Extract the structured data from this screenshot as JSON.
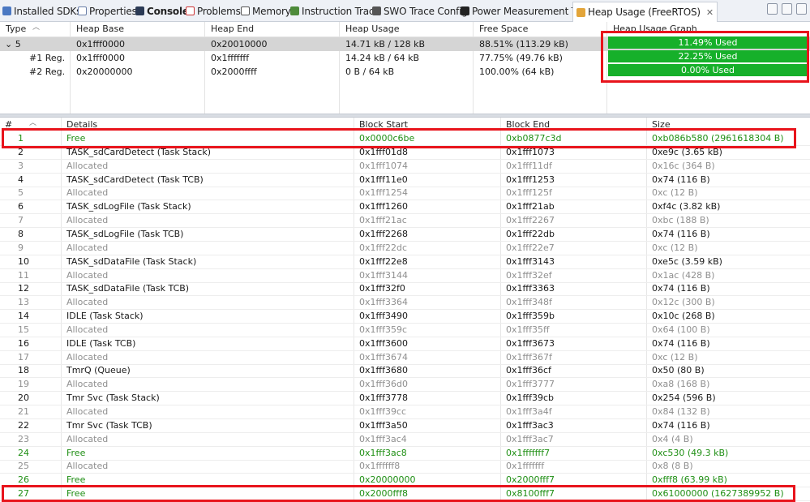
{
  "tabs": [
    {
      "label": "Installed SDKs",
      "icon": "sdk-icon",
      "active": false
    },
    {
      "label": "Properties",
      "icon": "properties-icon",
      "active": false
    },
    {
      "label": "Console",
      "icon": "console-icon",
      "active": false,
      "bold": true
    },
    {
      "label": "Problems",
      "icon": "problems-icon",
      "active": false
    },
    {
      "label": "Memory",
      "icon": "memory-icon",
      "active": false
    },
    {
      "label": "Instruction Trace",
      "icon": "trace-icon",
      "active": false
    },
    {
      "label": "SWO Trace Config",
      "icon": "swo-icon",
      "active": false
    },
    {
      "label": "Power Measurement Tool",
      "icon": "power-icon",
      "active": false
    },
    {
      "label": "Heap Usage (FreeRTOS)",
      "icon": "heap-icon",
      "active": true,
      "close": "✕"
    }
  ],
  "summary": {
    "columns": [
      "Type",
      "Heap Base",
      "Heap End",
      "Heap Usage",
      "Free Space",
      "Heap Usage Graph"
    ],
    "rows": [
      {
        "type": "5",
        "expander": "⌄",
        "base": "0x1fff0000",
        "end": "0x20010000",
        "usage": "14.71 kB / 128 kB",
        "free": "88.51% (113.29 kB)",
        "graph": "11.49% Used",
        "used_fraction": 1.0
      },
      {
        "type": "#1 Reg.",
        "base": "0x1fff0000",
        "end": "0x1fffffff",
        "usage": "14.24 kB / 64 kB",
        "free": "77.75% (49.76 kB)",
        "graph": "22.25% Used",
        "used_fraction": 1.0
      },
      {
        "type": "#2 Reg.",
        "base": "0x20000000",
        "end": "0x2000ffff",
        "usage": "0 B / 64 kB",
        "free": "100.00% (64 kB)",
        "graph": "0.00% Used",
        "used_fraction": 1.0
      }
    ]
  },
  "detail": {
    "columns": [
      "#",
      "Details",
      "Block Start",
      "Block End",
      "Size"
    ],
    "rows": [
      {
        "n": "1",
        "details": "Free",
        "start": "0x0000c6be",
        "end": "0xb0877c3d",
        "size": "0xb086b580 (2961618304 B)",
        "kind": "free"
      },
      {
        "n": "2",
        "details": "TASK_sdCardDetect (Task Stack)",
        "start": "0x1fff01d8",
        "end": "0x1fff1073",
        "size": "0xe9c (3.65 kB)",
        "kind": "task"
      },
      {
        "n": "3",
        "details": "Allocated",
        "start": "0x1fff1074",
        "end": "0x1fff11df",
        "size": "0x16c (364 B)",
        "kind": "alloc"
      },
      {
        "n": "4",
        "details": "TASK_sdCardDetect (Task TCB)",
        "start": "0x1fff11e0",
        "end": "0x1fff1253",
        "size": "0x74 (116 B)",
        "kind": "task"
      },
      {
        "n": "5",
        "details": "Allocated",
        "start": "0x1fff1254",
        "end": "0x1fff125f",
        "size": "0xc (12 B)",
        "kind": "alloc"
      },
      {
        "n": "6",
        "details": "TASK_sdLogFile (Task Stack)",
        "start": "0x1fff1260",
        "end": "0x1fff21ab",
        "size": "0xf4c (3.82 kB)",
        "kind": "task"
      },
      {
        "n": "7",
        "details": "Allocated",
        "start": "0x1fff21ac",
        "end": "0x1fff2267",
        "size": "0xbc (188 B)",
        "kind": "alloc"
      },
      {
        "n": "8",
        "details": "TASK_sdLogFile (Task TCB)",
        "start": "0x1fff2268",
        "end": "0x1fff22db",
        "size": "0x74 (116 B)",
        "kind": "task"
      },
      {
        "n": "9",
        "details": "Allocated",
        "start": "0x1fff22dc",
        "end": "0x1fff22e7",
        "size": "0xc (12 B)",
        "kind": "alloc"
      },
      {
        "n": "10",
        "details": "TASK_sdDataFile (Task Stack)",
        "start": "0x1fff22e8",
        "end": "0x1fff3143",
        "size": "0xe5c (3.59 kB)",
        "kind": "task"
      },
      {
        "n": "11",
        "details": "Allocated",
        "start": "0x1fff3144",
        "end": "0x1fff32ef",
        "size": "0x1ac (428 B)",
        "kind": "alloc"
      },
      {
        "n": "12",
        "details": "TASK_sdDataFile (Task TCB)",
        "start": "0x1fff32f0",
        "end": "0x1fff3363",
        "size": "0x74 (116 B)",
        "kind": "task"
      },
      {
        "n": "13",
        "details": "Allocated",
        "start": "0x1fff3364",
        "end": "0x1fff348f",
        "size": "0x12c (300 B)",
        "kind": "alloc"
      },
      {
        "n": "14",
        "details": "IDLE (Task Stack)",
        "start": "0x1fff3490",
        "end": "0x1fff359b",
        "size": "0x10c (268 B)",
        "kind": "task"
      },
      {
        "n": "15",
        "details": "Allocated",
        "start": "0x1fff359c",
        "end": "0x1fff35ff",
        "size": "0x64 (100 B)",
        "kind": "alloc"
      },
      {
        "n": "16",
        "details": "IDLE (Task TCB)",
        "start": "0x1fff3600",
        "end": "0x1fff3673",
        "size": "0x74 (116 B)",
        "kind": "task"
      },
      {
        "n": "17",
        "details": "Allocated",
        "start": "0x1fff3674",
        "end": "0x1fff367f",
        "size": "0xc (12 B)",
        "kind": "alloc"
      },
      {
        "n": "18",
        "details": "TmrQ (Queue)",
        "start": "0x1fff3680",
        "end": "0x1fff36cf",
        "size": "0x50 (80 B)",
        "kind": "task"
      },
      {
        "n": "19",
        "details": "Allocated",
        "start": "0x1fff36d0",
        "end": "0x1fff3777",
        "size": "0xa8 (168 B)",
        "kind": "alloc"
      },
      {
        "n": "20",
        "details": "Tmr Svc (Task Stack)",
        "start": "0x1fff3778",
        "end": "0x1fff39cb",
        "size": "0x254 (596 B)",
        "kind": "task"
      },
      {
        "n": "21",
        "details": "Allocated",
        "start": "0x1fff39cc",
        "end": "0x1fff3a4f",
        "size": "0x84 (132 B)",
        "kind": "alloc"
      },
      {
        "n": "22",
        "details": "Tmr Svc (Task TCB)",
        "start": "0x1fff3a50",
        "end": "0x1fff3ac3",
        "size": "0x74 (116 B)",
        "kind": "task"
      },
      {
        "n": "23",
        "details": "Allocated",
        "start": "0x1fff3ac4",
        "end": "0x1fff3ac7",
        "size": "0x4 (4 B)",
        "kind": "alloc"
      },
      {
        "n": "24",
        "details": "Free",
        "start": "0x1fff3ac8",
        "end": "0x1fffffff7",
        "size": "0xc530 (49.3 kB)",
        "kind": "free"
      },
      {
        "n": "25",
        "details": "Allocated",
        "start": "0x1ffffff8",
        "end": "0x1fffffff",
        "size": "0x8 (8 B)",
        "kind": "alloc"
      },
      {
        "n": "26",
        "details": "Free",
        "start": "0x20000000",
        "end": "0x2000fff7",
        "size": "0xfff8 (63.99 kB)",
        "kind": "free"
      },
      {
        "n": "27",
        "details": "Free",
        "start": "0x2000fff8",
        "end": "0x8100fff7",
        "size": "0x61000000 (1627389952 B)",
        "kind": "free"
      }
    ]
  },
  "colors": {
    "bar_green": "#16b02a",
    "free_text": "#1f8f14",
    "allocated_text": "#8f8f8f",
    "highlight": "#e8141c"
  }
}
